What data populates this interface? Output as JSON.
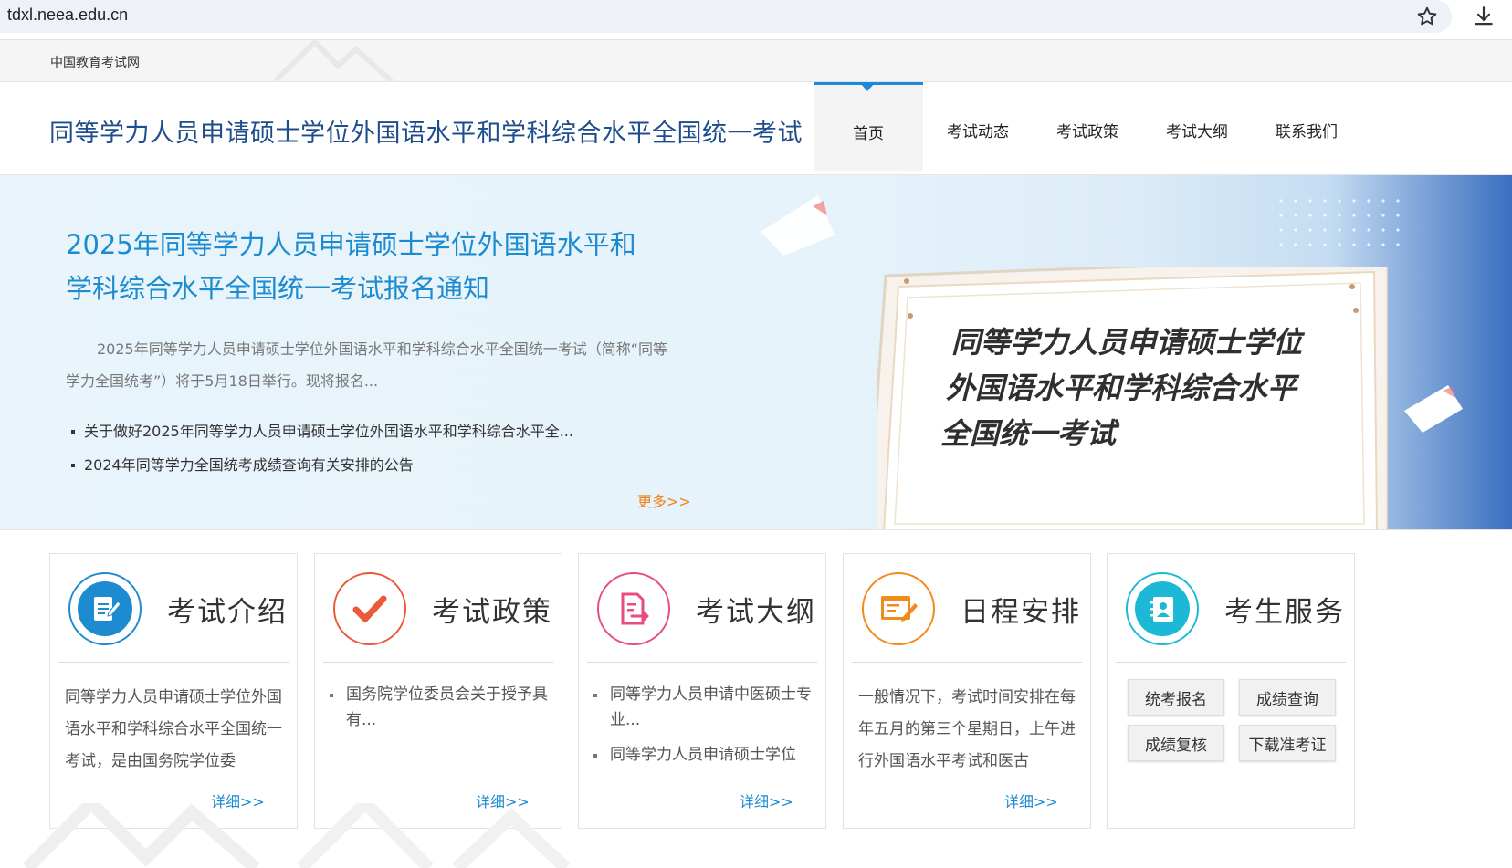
{
  "browser": {
    "url": "tdxl.neea.edu.cn"
  },
  "topbar": {
    "site_name": "中国教育考试网"
  },
  "header": {
    "title": "同等学力人员申请硕士学位外国语水平和学科综合水平全国统一考试"
  },
  "nav": {
    "items": [
      {
        "label": "首页",
        "active": true
      },
      {
        "label": "考试动态"
      },
      {
        "label": "考试政策"
      },
      {
        "label": "考试大纲"
      },
      {
        "label": "联系我们"
      }
    ]
  },
  "banner": {
    "title_line1": "2025年同等学力人员申请硕士学位外国语水平和",
    "title_line2": "学科综合水平全国统一考试报名通知",
    "description": "2025年同等学力人员申请硕士学位外国语水平和学科综合水平全国统一考试（简称“同等学力全国统考”）将于5月18日举行。现将报名...",
    "links": [
      "关于做好2025年同等学力人员申请硕士学位外国语水平和学科综合水平全...",
      "2024年同等学力全国统考成绩查询有关安排的公告"
    ],
    "more": "更多>>",
    "board_line1": "同等学力人员申请硕士学位",
    "board_line2": "外国语水平和学科综合水平",
    "board_line3": "全国统一考试"
  },
  "cards": {
    "intro": {
      "title": "考试介绍",
      "icon": "document-edit-icon",
      "color": "#1d8bd0",
      "text": "同等学力人员申请硕士学位外国语水平和学科综合水平全国统一考试，是由国务院学位委",
      "detail": "详细>>"
    },
    "policy": {
      "title": "考试政策",
      "icon": "checkmark-icon",
      "color": "#e9593a",
      "items": [
        "国务院学位委员会关于授予具有..."
      ],
      "detail": "详细>>"
    },
    "syllabus": {
      "title": "考试大纲",
      "icon": "file-export-icon",
      "color": "#e64c85",
      "items": [
        "同等学力人员申请中医硕士专业...",
        "同等学力人员申请硕士学位"
      ],
      "detail": "详细>>"
    },
    "schedule": {
      "title": "日程安排",
      "icon": "calendar-edit-icon",
      "color": "#f28a1c",
      "text": "一般情况下，考试时间安排在每年五月的第三个星期日，上午进行外国语水平考试和医古",
      "detail": "详细>>"
    },
    "service": {
      "title": "考生服务",
      "icon": "contacts-book-icon",
      "color": "#1cb9d6",
      "buttons": [
        "统考报名",
        "成绩查询",
        "成绩复核",
        "下载准考证"
      ]
    }
  }
}
